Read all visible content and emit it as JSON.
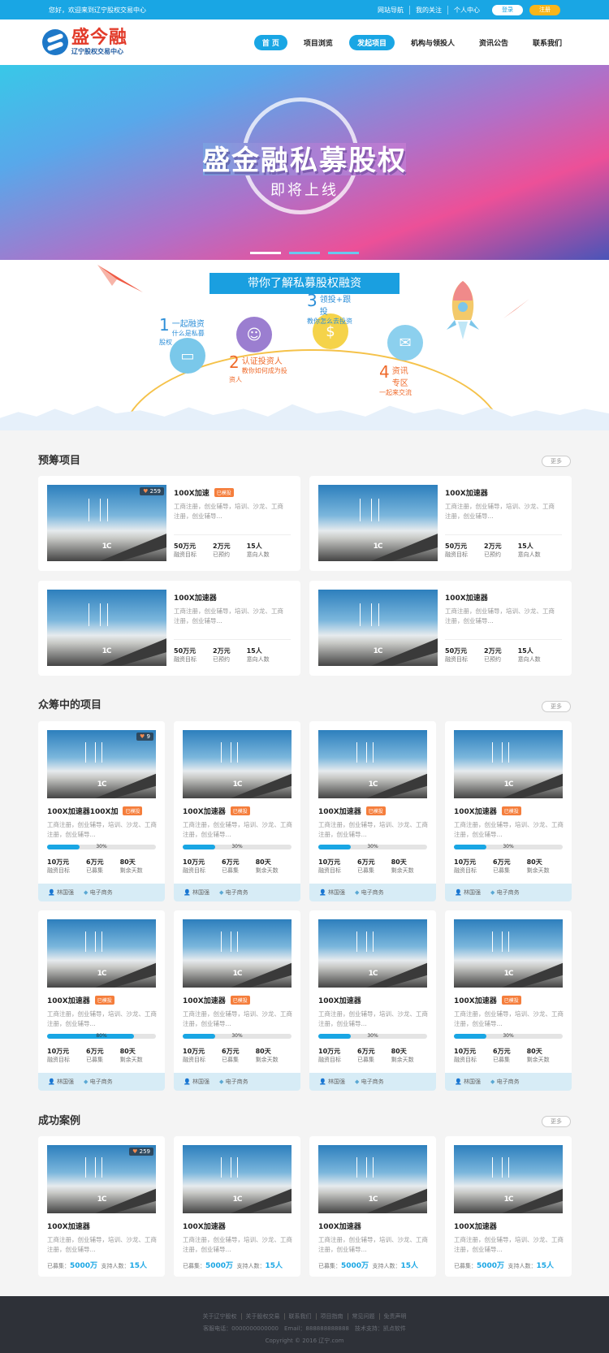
{
  "topbar": {
    "welcome": "您好，欢迎来到辽宁股权交易中心",
    "links": [
      "网站导航",
      "我的关注",
      "个人中心"
    ],
    "login": "登录",
    "register": "注册"
  },
  "header": {
    "logo_cn": "盛今融",
    "logo_sub": "辽宁股权交易中心",
    "nav": [
      "首 页",
      "项目浏览",
      "发起项目",
      "机构与领投人",
      "资讯公告",
      "联系我们"
    ]
  },
  "banner": {
    "title": "盛金融私募股权",
    "subtitle": "即将上线"
  },
  "intro": {
    "ribbon": "带你了解私募股权融资",
    "steps": [
      {
        "num": "1",
        "title": "一起融资",
        "desc": "什么是私募股权"
      },
      {
        "num": "2",
        "title": "认证投资人",
        "desc": "教你如何成为投资人"
      },
      {
        "num": "3",
        "title": "领投+跟投",
        "desc": "教你怎么去投资"
      },
      {
        "num": "4",
        "title": "资讯专区",
        "desc": "一起来交流"
      }
    ]
  },
  "sections": {
    "pre": "预筹项目",
    "crowd": "众筹中的项目",
    "success": "成功案例",
    "more": "更多"
  },
  "pre_cards": [
    {
      "title": "100X加速",
      "tag": "已模投",
      "like": "259",
      "desc1": "工商注册，创业辅导，培训、沙龙、工商",
      "desc2": "注册，创业辅导...",
      "s1v": "50万元",
      "s1l": "融资目标",
      "s2v": "2万元",
      "s2l": "已预约",
      "s3v": "15人",
      "s3l": "意向人数"
    },
    {
      "title": "100X加速器",
      "tag": "",
      "like": "",
      "desc1": "工商注册，创业辅导，培训、沙龙、工商",
      "desc2": "注册，创业辅导...",
      "s1v": "50万元",
      "s1l": "融资目标",
      "s2v": "2万元",
      "s2l": "已预约",
      "s3v": "15人",
      "s3l": "意向人数"
    },
    {
      "title": "100X加速器",
      "tag": "",
      "like": "",
      "desc1": "工商注册，创业辅导，培训、沙龙、工商",
      "desc2": "注册，创业辅导...",
      "s1v": "50万元",
      "s1l": "融资目标",
      "s2v": "2万元",
      "s2l": "已预约",
      "s3v": "15人",
      "s3l": "意向人数"
    },
    {
      "title": "100X加速器",
      "tag": "",
      "like": "",
      "desc1": "工商注册，创业辅导，培训、沙龙、工商",
      "desc2": "注册，创业辅导...",
      "s1v": "50万元",
      "s1l": "融资目标",
      "s2v": "2万元",
      "s2l": "已预约",
      "s3v": "15人",
      "s3l": "意向人数"
    }
  ],
  "crowd_cards": [
    {
      "title": "100X加速器100X加",
      "tag": "已模投",
      "like": "9",
      "pct": "30%",
      "p": 0.3
    },
    {
      "title": "100X加速器",
      "tag": "已模投",
      "like": "",
      "pct": "30%",
      "p": 0.3
    },
    {
      "title": "100X加速器",
      "tag": "已模投",
      "like": "",
      "pct": "30%",
      "p": 0.3
    },
    {
      "title": "100X加速器",
      "tag": "已模投",
      "like": "",
      "pct": "30%",
      "p": 0.3
    },
    {
      "title": "100X加速器",
      "tag": "已模投",
      "like": "",
      "pct": "80%",
      "p": 0.8
    },
    {
      "title": "100X加速器",
      "tag": "已模投",
      "like": "",
      "pct": "30%",
      "p": 0.3
    },
    {
      "title": "100X加速器",
      "tag": "",
      "like": "",
      "pct": "30%",
      "p": 0.3
    },
    {
      "title": "100X加速器",
      "tag": "已模投",
      "like": "",
      "pct": "30%",
      "p": 0.3
    }
  ],
  "crowd_common": {
    "desc1": "工商注册，创业辅导，培训、沙龙、工商",
    "desc2": "注册，创业辅导...",
    "s1v": "10万元",
    "s1l": "融资目标",
    "s2v": "6万元",
    "s2l": "已募集",
    "s3v": "80天",
    "s3l": "剩余天数",
    "user": "林国强",
    "category": "电子商务"
  },
  "success_cards": [
    {
      "title": "100X加速器",
      "like": "259"
    },
    {
      "title": "100X加速器",
      "like": ""
    },
    {
      "title": "100X加速器",
      "like": ""
    },
    {
      "title": "100X加速器",
      "like": ""
    }
  ],
  "success_common": {
    "desc1": "工商注册，创业辅导，培训、沙龙、工商",
    "desc2": "注册，创业辅导...",
    "raised_label": "已募集：",
    "raised": "5000万",
    "backers_label": "支持人数：",
    "backers": "15人"
  },
  "footer": {
    "links": [
      "关于辽宁股权",
      "关于股权交易",
      "联系我们",
      "项目指南",
      "常见问题",
      "免责声明"
    ],
    "contact": "客服电话：0000000000000　Email：888888888888　技术支持：凯点软件",
    "copyright": "Copyright © 2016 辽宁.com"
  },
  "colors": {
    "accent": "#19a6e4",
    "tag": "#f57e3c",
    "footer": "#2e3138"
  }
}
